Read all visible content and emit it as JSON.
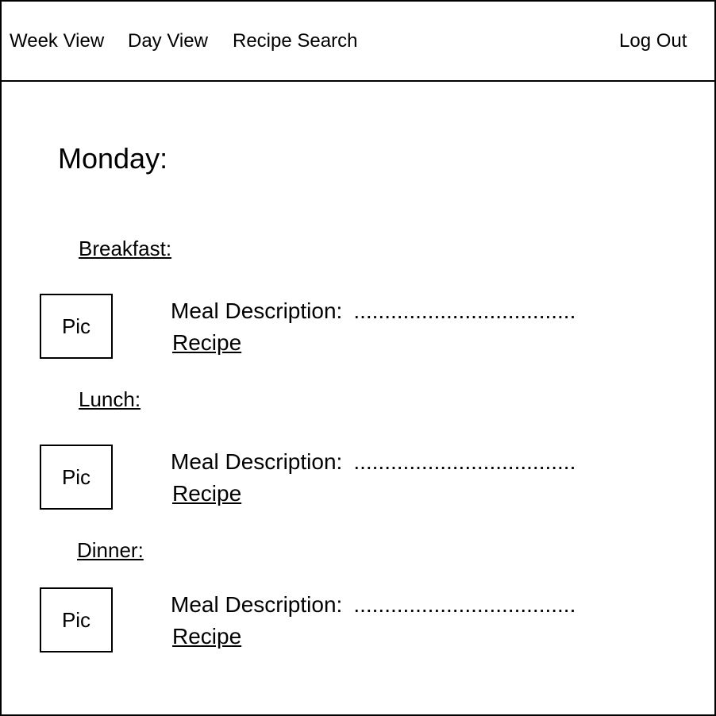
{
  "nav": {
    "week_view": "Week View",
    "day_view": "Day View",
    "recipe_search": "Recipe Search",
    "log_out": "Log Out"
  },
  "day": {
    "title": "Monday:"
  },
  "meals": [
    {
      "heading": "Breakfast:",
      "pic_label": "Pic",
      "description_label": "Meal Description:",
      "description_value": "....................................",
      "recipe_link": "Recipe"
    },
    {
      "heading": "Lunch:",
      "pic_label": "Pic",
      "description_label": "Meal Description:",
      "description_value": "....................................",
      "recipe_link": "Recipe"
    },
    {
      "heading": "Dinner:",
      "pic_label": "Pic",
      "description_label": "Meal Description:",
      "description_value": "....................................",
      "recipe_link": "Recipe"
    }
  ]
}
